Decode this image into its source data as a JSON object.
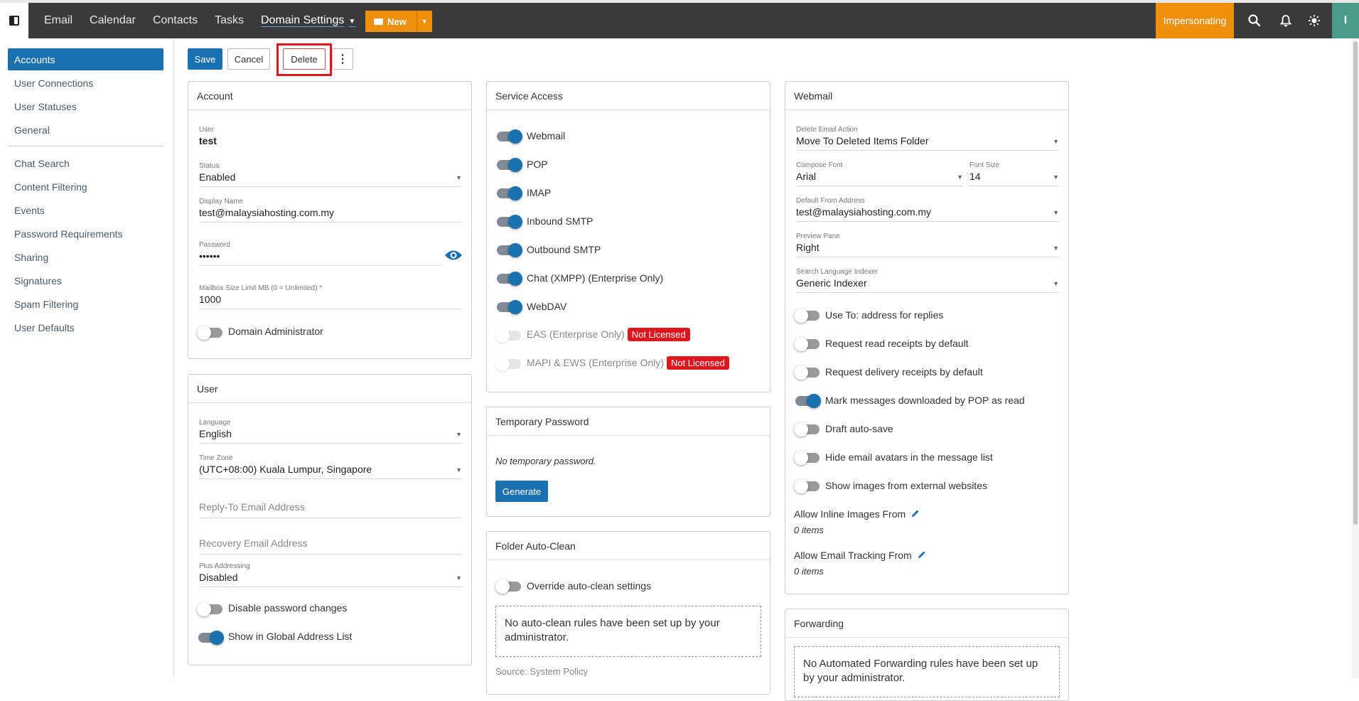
{
  "topbar": {
    "nav": [
      "Email",
      "Calendar",
      "Contacts",
      "Tasks"
    ],
    "active_nav": "Domain Settings",
    "new_label": "New",
    "impersonating": "Impersonating",
    "avatar_initial": "I"
  },
  "sidebar": {
    "items": [
      "Accounts",
      "User Connections",
      "User Statuses",
      "General",
      "Chat Search",
      "Content Filtering",
      "Events",
      "Password Requirements",
      "Sharing",
      "Signatures",
      "Spam Filtering",
      "User Defaults"
    ]
  },
  "toolbar": {
    "save": "Save",
    "cancel": "Cancel",
    "delete": "Delete",
    "more": "⋮"
  },
  "account": {
    "title": "Account",
    "user_label": "User",
    "user_value": "test",
    "status_label": "Status",
    "status_value": "Enabled",
    "display_name_label": "Display Name",
    "display_name_value": "test@malaysiahosting.com.my",
    "password_label": "Password",
    "password_value": "••••••",
    "mailbox_label": "Mailbox Size Limit MB (0 = Unlimited) *",
    "mailbox_value": "1000",
    "domain_admin_label": "Domain Administrator"
  },
  "user": {
    "title": "User",
    "language_label": "Language",
    "language_value": "English",
    "timezone_label": "Time Zone",
    "timezone_value": "(UTC+08:00) Kuala Lumpur, Singapore",
    "reply_to_placeholder": "Reply-To Email Address",
    "recovery_placeholder": "Recovery Email Address",
    "plus_label": "Plus Addressing",
    "plus_value": "Disabled",
    "disable_pw_label": "Disable password changes",
    "show_gal_label": "Show in Global Address List"
  },
  "service_access": {
    "title": "Service Access",
    "items": [
      "Webmail",
      "POP",
      "IMAP",
      "Inbound SMTP",
      "Outbound SMTP",
      "Chat (XMPP) (Enterprise Only)",
      "WebDAV",
      "EAS (Enterprise Only)",
      "MAPI & EWS (Enterprise Only)"
    ],
    "not_licensed": "Not Licensed"
  },
  "temp_password": {
    "title": "Temporary Password",
    "message": "No temporary password.",
    "generate": "Generate"
  },
  "folder_autoclean": {
    "title": "Folder Auto-Clean",
    "override_label": "Override auto-clean settings",
    "message": "No auto-clean rules have been set up by your administrator.",
    "source": "Source: System Policy"
  },
  "webmail": {
    "title": "Webmail",
    "delete_action_label": "Delete Email Action",
    "delete_action_value": "Move To Deleted Items Folder",
    "compose_font_label": "Compose Font",
    "compose_font_value": "Arial",
    "font_size_label": "Font Size",
    "font_size_value": "14",
    "default_from_label": "Default From Address",
    "default_from_value": "test@malaysiahosting.com.my",
    "preview_label": "Preview Pane",
    "preview_value": "Right",
    "indexer_label": "Search Language Indexer",
    "indexer_value": "Generic Indexer",
    "toggles": [
      "Use To: address for replies",
      "Request read receipts by default",
      "Request delivery receipts by default",
      "Mark messages downloaded by POP as read",
      "Draft auto-save",
      "Hide email avatars in the message list",
      "Show images from external websites"
    ],
    "inline_images_label": "Allow Inline Images From",
    "inline_images_value": "0 items",
    "tracking_label": "Allow Email Tracking From",
    "tracking_value": "0 items"
  },
  "forwarding": {
    "title": "Forwarding",
    "message": "No Automated Forwarding rules have been set up by your administrator."
  }
}
